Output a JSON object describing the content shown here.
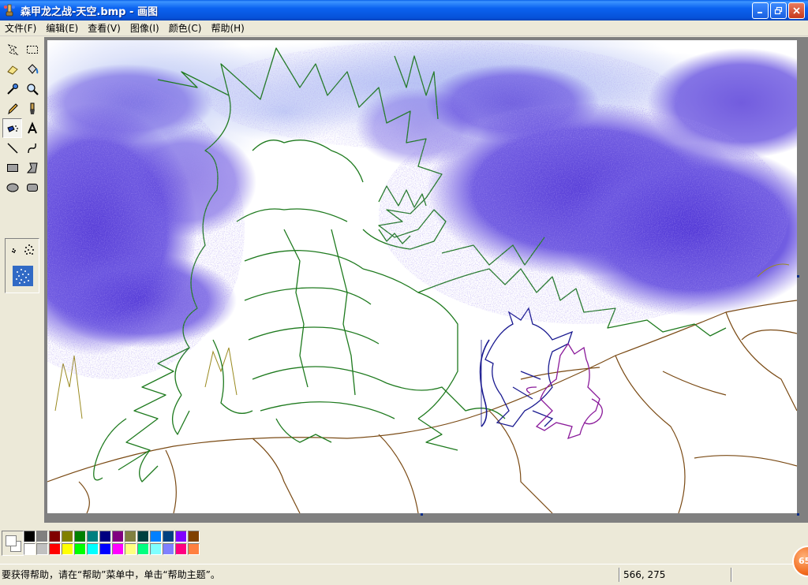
{
  "window": {
    "title": "森甲龙之战-天空.bmp - 画图",
    "buttons": {
      "minimize": "minimize-icon",
      "maximize": "restore-icon",
      "close": "close-icon"
    }
  },
  "menu": [
    "文件(F)",
    "编辑(E)",
    "查看(V)",
    "图像(I)",
    "颜色(C)",
    "帮助(H)"
  ],
  "tools": [
    "free-select-icon",
    "rect-select-icon",
    "eraser-icon",
    "fill-bucket-icon",
    "color-picker-icon",
    "magnifier-icon",
    "pencil-icon",
    "brush-icon",
    "airbrush-icon",
    "text-icon",
    "line-icon",
    "curve-icon",
    "rectangle-icon",
    "polygon-icon",
    "ellipse-icon",
    "rounded-rect-icon"
  ],
  "selected_tool": "airbrush-icon",
  "palette": {
    "foreground": "#FFFFFF",
    "background": "#FFFFFF",
    "colors": [
      "#000000",
      "#808080",
      "#800000",
      "#808000",
      "#008000",
      "#008080",
      "#000080",
      "#800080",
      "#808040",
      "#004040",
      "#0080FF",
      "#004080",
      "#8000FF",
      "#804000",
      "#FFFFFF",
      "#C0C0C0",
      "#FF0000",
      "#FFFF00",
      "#00FF00",
      "#00FFFF",
      "#0000FF",
      "#FF00FF",
      "#FFFF80",
      "#00FF80",
      "#80FFFF",
      "#8080FF",
      "#FF0080",
      "#FF8040"
    ]
  },
  "status": {
    "help_text": "要获得帮助，请在“帮助”菜单中，单击“帮助主题”。",
    "coordinates": "566, 275"
  },
  "taskbar_badge": "65"
}
